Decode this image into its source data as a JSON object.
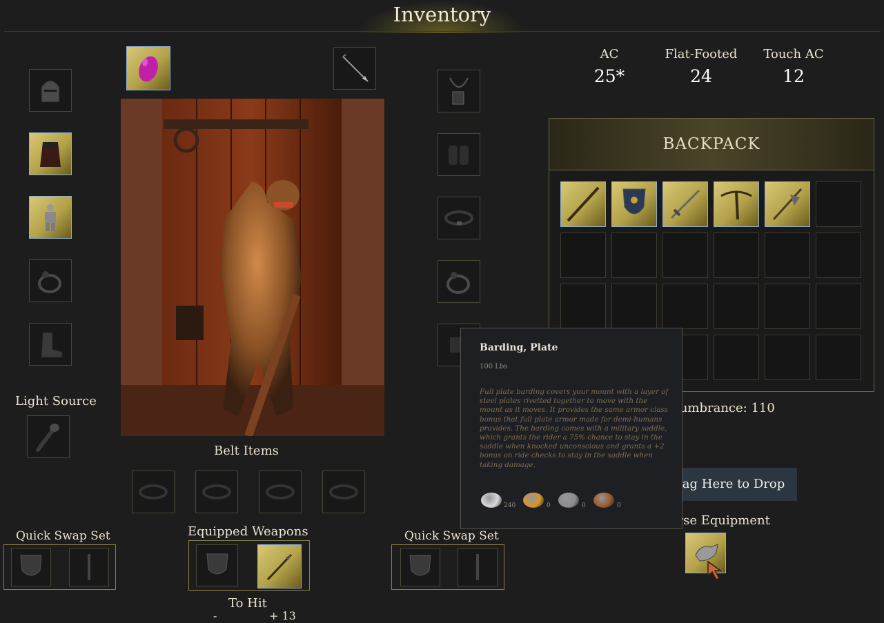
{
  "title": "Inventory",
  "stats": [
    {
      "label": "AC",
      "value": "25*"
    },
    {
      "label": "Flat-Footed",
      "value": "24"
    },
    {
      "label": "Touch AC",
      "value": "12"
    }
  ],
  "equipment_left": [
    {
      "name": "helmet-slot",
      "icon": "helmet-icon",
      "highlighted": false
    },
    {
      "name": "cloak-slot",
      "icon": "cloak-icon",
      "highlighted": true
    },
    {
      "name": "armor-slot",
      "icon": "plate-armor-icon",
      "highlighted": true
    },
    {
      "name": "ring-slot-left",
      "icon": "ring-icon",
      "highlighted": false
    },
    {
      "name": "boots-slot",
      "icon": "boots-icon",
      "highlighted": false
    }
  ],
  "equipment_right": [
    {
      "name": "amulet-slot",
      "icon": "amulet-icon",
      "highlighted": false
    },
    {
      "name": "gloves-slot",
      "icon": "gauntlets-icon",
      "highlighted": false
    },
    {
      "name": "belt-slot",
      "icon": "belt-icon",
      "highlighted": false
    },
    {
      "name": "ring-slot-right",
      "icon": "ring-icon",
      "highlighted": false
    },
    {
      "name": "bracers-slot",
      "icon": "bracers-icon",
      "highlighted": false
    }
  ],
  "top_slots": [
    {
      "name": "gem-slot",
      "icon": "purple-gem-icon",
      "highlighted": true
    },
    {
      "name": "ammo-slot",
      "icon": "arrow-icon",
      "highlighted": false
    }
  ],
  "light_source": {
    "label": "Light Source",
    "icon": "torch-icon"
  },
  "belt_items": {
    "label": "Belt Items",
    "slots": [
      "belt-icon",
      "belt-icon",
      "belt-icon",
      "belt-icon"
    ]
  },
  "quick_swap_left": {
    "label": "Quick Swap Set",
    "items": [
      "shield-icon",
      "dagger-icon"
    ]
  },
  "equipped_weapons": {
    "label": "Equipped Weapons",
    "items": [
      "shield-icon",
      "spear-icon"
    ]
  },
  "quick_swap_right": {
    "label": "Quick Swap Set",
    "items": [
      "shield-icon",
      "dagger-icon"
    ]
  },
  "to_hit": {
    "label": "To Hit",
    "left": "-",
    "right": "+ 13"
  },
  "backpack": {
    "title": "BACKPACK",
    "items": [
      "quarterstaff-icon",
      "heater-shield-icon",
      "longsword-icon",
      "crossbow-icon",
      "halberd-icon"
    ],
    "total_cells": 24
  },
  "encumbrance": {
    "label": "Encumbrance: 110"
  },
  "drop_zone": {
    "label": "Drag Here to Drop"
  },
  "horse_equipment": {
    "label": "Horse Equipment",
    "icon": "barding-icon"
  },
  "tooltip": {
    "name": "Barding, Plate",
    "weight": "100 Lbs",
    "description": "Full plate barding covers your mount with a layer of steel plates rivetted together to move with the mount as it moves. It provides the same armor class bonus that full plate armor made for demi-humans provides. The barding comes with a military saddle, which grants the rider a 75% chance to stay in the saddle when knocked unconscious and grants a +2 bonus on ride checks to stay in the saddle when taking damage.",
    "coins": [
      {
        "name": "platinum",
        "value": "240",
        "color": "#d8d8d8"
      },
      {
        "name": "gold",
        "value": "0",
        "color": "#d7952a"
      },
      {
        "name": "silver",
        "value": "0",
        "color": "#8d8d8d"
      },
      {
        "name": "copper",
        "value": "0",
        "color": "#9a5a2d"
      }
    ]
  },
  "colors": {
    "accent_gold": "#c9b863",
    "slot_highlight_border": "#8fb0d0",
    "background": "#1d1d1d"
  }
}
